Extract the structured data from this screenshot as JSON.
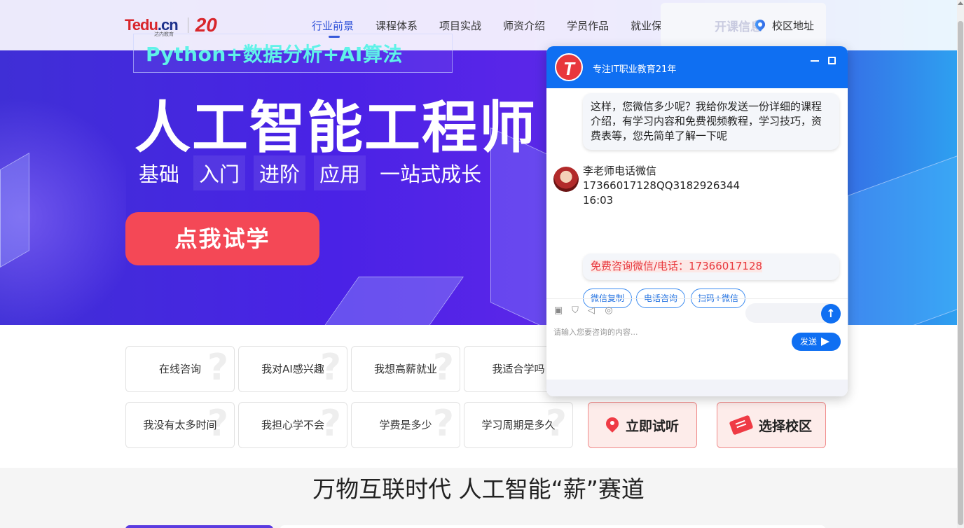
{
  "header": {
    "logo": {
      "brand_main": "Tedu",
      "brand_tld": ".cn",
      "brand_sub": "达内教育",
      "anniversary": "20"
    },
    "nav": [
      {
        "label": "行业前景",
        "active": true
      },
      {
        "label": "课程体系",
        "active": false
      },
      {
        "label": "项目实战",
        "active": false
      },
      {
        "label": "师资介绍",
        "active": false
      },
      {
        "label": "学员作品",
        "active": false
      },
      {
        "label": "就业保障",
        "active": false
      }
    ],
    "open_class_label": "开课信息",
    "campus_label": "校区地址"
  },
  "hero": {
    "subtitle": "Python+数据分析+AI算法",
    "headline": "人工智能工程师",
    "tags": [
      "基础",
      "入门",
      "进阶",
      "应用",
      "一站式成长"
    ],
    "cta": "点我试学"
  },
  "questions": {
    "row1": [
      "在线咨询",
      "我对AI感兴趣",
      "我想高薪就业",
      "我适合学吗"
    ],
    "row2": [
      "我没有太多时间",
      "我担心学不会",
      "学费是多少",
      "学习周期是多久"
    ],
    "actions": {
      "try_listen": "立即试听",
      "choose_campus": "选择校区"
    }
  },
  "section2": {
    "title": "万物互联时代 人工智能“薪”赛道"
  },
  "chat": {
    "logo_letter": "T",
    "title": "专注IT职业教育21年",
    "message1": "这样，您微信多少呢？我给你发送一份详细的课程介绍，有学习内容和免费视频教程，学习技巧，资费表等，您先简单了解一下呢",
    "agent_name": "李老师电话微信",
    "agent_contact": "17366017128QQ3182926344",
    "time": "16:03",
    "message2": "免费咨询微信/电话：17366017128",
    "quick_replies": [
      "微信复制",
      "电话咨询",
      "扫码+微信"
    ],
    "input_placeholder": "请输入您要咨询的内容...",
    "send_label": "发送"
  },
  "colors": {
    "accent_blue": "#0f6ff2",
    "cta_red": "#f44856",
    "subtitle_cyan": "#5ff2e8",
    "nav_active": "#2b4fd8"
  },
  "icons": [
    "location-pin-icon",
    "image-icon",
    "shield-icon",
    "sound-icon",
    "wechat-icon",
    "arrow-up-icon",
    "send-icon",
    "minimize-icon",
    "maximize-icon",
    "ticket-icon"
  ]
}
